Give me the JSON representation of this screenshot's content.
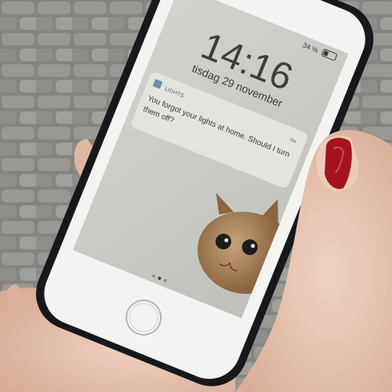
{
  "lockscreen": {
    "status_battery": "34 %",
    "time": "14:16",
    "date": "tisdag 29 november",
    "page_dots_count": 3,
    "active_page_dot": 1
  },
  "notification": {
    "app_name": "LIGHTS",
    "when": "nu",
    "message_line1": "You forgot your lights at home. Should I turn",
    "message_line2": "them off?"
  },
  "colors": {
    "pavement": "#8a8884",
    "phone_body": "#16181b",
    "screen": "#c9ccc4",
    "notification_bg": "#e4e6df",
    "text_dark": "#3a3d3a",
    "nail_polish": "#a3141d",
    "skin": "#e7c6b2",
    "cat_fur": "#a27c55"
  }
}
